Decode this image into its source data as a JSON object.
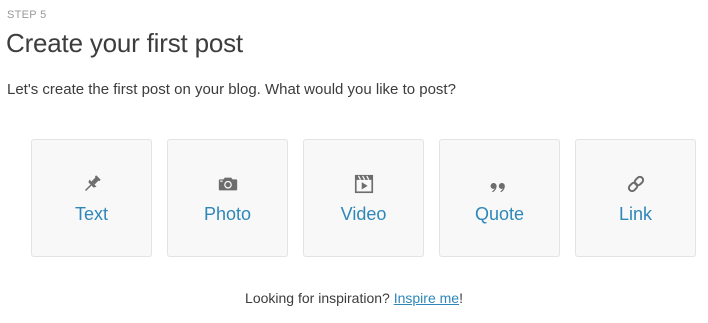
{
  "header": {
    "step": "STEP 5",
    "title": "Create your first post",
    "intro": "Let's create the first post on your blog. What would you like to post?"
  },
  "post_types": [
    {
      "label": "Text",
      "icon": "pushpin-icon"
    },
    {
      "label": "Photo",
      "icon": "camera-icon"
    },
    {
      "label": "Video",
      "icon": "clapperboard-icon"
    },
    {
      "label": "Quote",
      "icon": "quote-icon"
    },
    {
      "label": "Link",
      "icon": "chain-link-icon"
    }
  ],
  "footer": {
    "prefix": "Looking for inspiration? ",
    "link": "Inspire me",
    "suffix": "!"
  },
  "colors": {
    "accent": "#2e87b8",
    "icon": "#6d6d6d",
    "tile_bg": "#f8f8f8",
    "tile_border": "#e3e3e3"
  }
}
